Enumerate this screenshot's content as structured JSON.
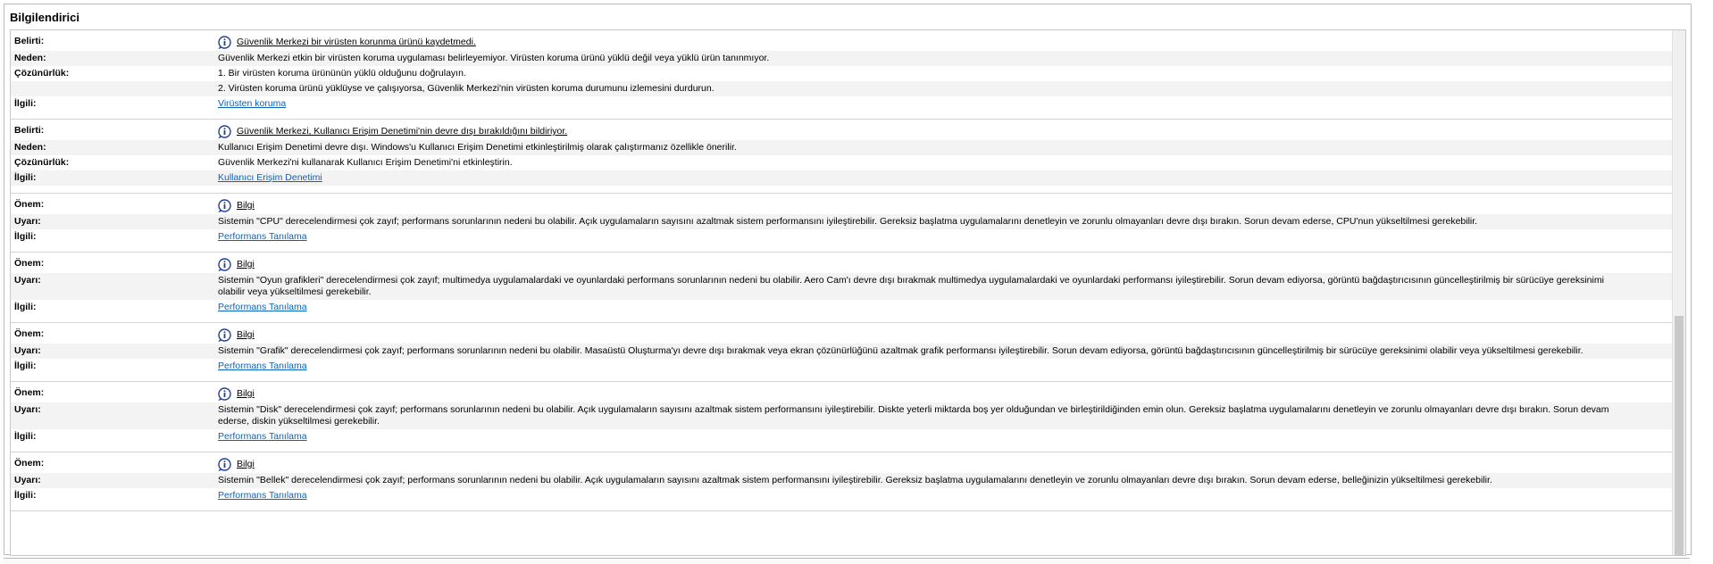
{
  "panel": {
    "title": "Bilgilendirici"
  },
  "groups": [
    {
      "rows": [
        {
          "label": "Belirti:",
          "value": "Güvenlik Merkezi bir virüsten korunma ürünü kaydetmedi.",
          "type": "symptom",
          "icon": "info-icon"
        },
        {
          "label": "Neden:",
          "value": "Güvenlik Merkezi etkin bir virüsten koruma uygulaması belirleyemiyor. Virüsten koruma ürünü yüklü değil veya yüklü ürün tanınmıyor.",
          "type": "text"
        },
        {
          "label": "Çözünürlük:",
          "value": "1. Bir virüsten koruma ürününün yüklü olduğunu doğrulayın.",
          "type": "text"
        },
        {
          "label": "",
          "value": "2. Virüsten koruma ürünü yüklüyse ve çalışıyorsa, Güvenlik Merkezi'nin virüsten koruma durumunu izlemesini durdurun.",
          "type": "text"
        },
        {
          "label": "İlgili:",
          "value": "Virüsten koruma",
          "type": "link"
        }
      ]
    },
    {
      "rows": [
        {
          "label": "Belirti:",
          "value": "Güvenlik Merkezi, Kullanıcı Erişim Denetimi'nin devre dışı bırakıldığını bildiriyor.",
          "type": "symptom",
          "icon": "info-icon"
        },
        {
          "label": "Neden:",
          "value": "Kullanıcı Erişim Denetimi devre dışı. Windows'u Kullanıcı Erişim Denetimi etkinleştirilmiş olarak çalıştırmanız özellikle önerilir.",
          "type": "text"
        },
        {
          "label": "Çözünürlük:",
          "value": "Güvenlik Merkezi'ni kullanarak Kullanıcı Erişim Denetimi'ni etkinleştirin.",
          "type": "text"
        },
        {
          "label": "İlgili:",
          "value": "Kullanıcı Erişim Denetimi",
          "type": "link"
        }
      ]
    },
    {
      "rows": [
        {
          "label": "Önem:",
          "value": "Bilgi",
          "type": "symptom",
          "icon": "info-icon"
        },
        {
          "label": "Uyarı:",
          "value": "Sistemin \"CPU\" derecelendirmesi çok zayıf; performans sorunlarının nedeni bu olabilir. Açık uygulamaların sayısını azaltmak sistem performansını iyileştirebilir. Gereksiz başlatma uygulamalarını denetleyin ve zorunlu olmayanları devre dışı bırakın. Sorun devam ederse, CPU'nun yükseltilmesi gerekebilir.",
          "type": "text"
        },
        {
          "label": "İlgili:",
          "value": "Performans Tanılama",
          "type": "link"
        }
      ]
    },
    {
      "rows": [
        {
          "label": "Önem:",
          "value": "Bilgi",
          "type": "symptom",
          "icon": "info-icon"
        },
        {
          "label": "Uyarı:",
          "value": "Sistemin \"Oyun grafikleri\" derecelendirmesi çok zayıf; multimedya uygulamalardaki ve oyunlardaki performans sorunlarının nedeni bu olabilir. Aero Cam'ı devre dışı bırakmak multimedya uygulamalardaki ve oyunlardaki performansı iyileştirebilir. Sorun devam ediyorsa, görüntü bağdaştırıcısının güncelleştirilmiş bir sürücüye gereksinimi olabilir veya yükseltilmesi gerekebilir.",
          "type": "text"
        },
        {
          "label": "İlgili:",
          "value": "Performans Tanılama",
          "type": "link"
        }
      ]
    },
    {
      "rows": [
        {
          "label": "Önem:",
          "value": "Bilgi",
          "type": "symptom",
          "icon": "info-icon"
        },
        {
          "label": "Uyarı:",
          "value": "Sistemin \"Grafik\" derecelendirmesi çok zayıf; performans sorunlarının nedeni bu olabilir. Masaüstü Oluşturma'yı devre dışı bırakmak veya ekran çözünürlüğünü azaltmak grafik performansı iyileştirebilir. Sorun devam ediyorsa, görüntü bağdaştırıcısının güncelleştirilmiş bir sürücüye gereksinimi olabilir veya yükseltilmesi gerekebilir.",
          "type": "text"
        },
        {
          "label": "İlgili:",
          "value": "Performans Tanılama",
          "type": "link"
        }
      ]
    },
    {
      "rows": [
        {
          "label": "Önem:",
          "value": "Bilgi",
          "type": "symptom",
          "icon": "info-icon"
        },
        {
          "label": "Uyarı:",
          "value": "Sistemin \"Disk\" derecelendirmesi çok zayıf; performans sorunlarının nedeni bu olabilir. Açık uygulamaların sayısını azaltmak sistem performansını iyileştirebilir. Diskte yeterli miktarda boş yer olduğundan ve birleştirildiğinden emin olun. Gereksiz başlatma uygulamalarını denetleyin ve zorunlu olmayanları devre dışı bırakın. Sorun devam ederse, diskin yükseltilmesi gerekebilir.",
          "type": "text"
        },
        {
          "label": "İlgili:",
          "value": "Performans Tanılama",
          "type": "link"
        }
      ]
    },
    {
      "rows": [
        {
          "label": "Önem:",
          "value": "Bilgi",
          "type": "symptom",
          "icon": "info-icon"
        },
        {
          "label": "Uyarı:",
          "value": "Sistemin \"Bellek\" derecelendirmesi çok zayıf; performans sorunlarının nedeni bu olabilir. Açık uygulamaların sayısını azaltmak sistem performansını iyileştirebilir. Gereksiz başlatma uygulamalarını denetleyin ve zorunlu olmayanları devre dışı bırakın. Sorun devam ederse, belleğinizin yükseltilmesi gerekebilir.",
          "type": "text"
        },
        {
          "label": "İlgili:",
          "value": "Performans Tanılama",
          "type": "link"
        }
      ]
    }
  ],
  "colors": {
    "link": "#0b62b8",
    "alt_row": "#f3f3f3",
    "border": "#b9b9b9",
    "icon": "#1f3f9a"
  }
}
